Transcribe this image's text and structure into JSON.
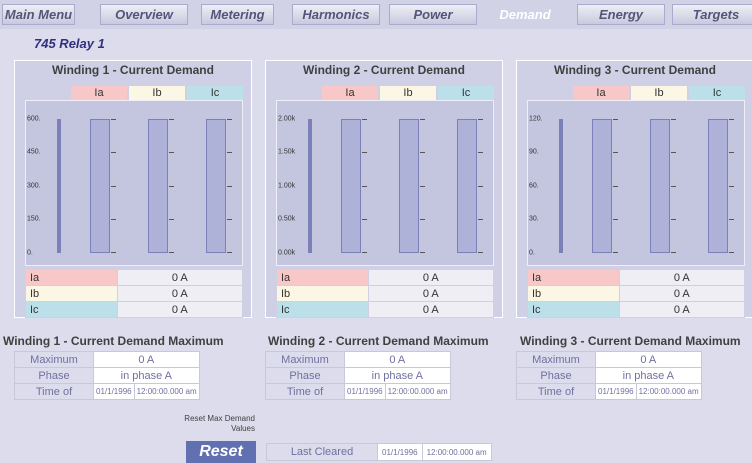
{
  "nav": {
    "tabs": [
      {
        "label": "Main Menu",
        "active": false
      },
      {
        "label": "Overview",
        "active": false
      },
      {
        "label": "Metering",
        "active": false
      },
      {
        "label": "Harmonics",
        "active": false
      },
      {
        "label": "Power",
        "active": false
      },
      {
        "label": "Demand",
        "active": true
      },
      {
        "label": "Energy",
        "active": false
      },
      {
        "label": "Targets",
        "active": false
      }
    ]
  },
  "relay_name": "745 Relay 1",
  "colors": {
    "ia": "#f8c8c8",
    "ib": "#fcf6e4",
    "ic": "#bce0ea",
    "bar_fill": "#5c63b0",
    "accent": "#6070b0"
  },
  "windings": [
    {
      "title": "Winding 1 - Current Demand",
      "phases": [
        "Ia",
        "Ib",
        "Ic"
      ],
      "ticks": [
        "600.",
        "450.",
        "300.",
        "150.",
        "0."
      ],
      "values": [
        "0 A",
        "0 A",
        "0 A"
      ],
      "levels": [
        0,
        0,
        0
      ],
      "max": {
        "title": "Winding 1 - Current Demand Maximum",
        "max_label": "Maximum",
        "max_value": "0 A",
        "phase_label": "Phase",
        "phase_value": "in phase A",
        "time_label": "Time of",
        "date": "01/1/1996",
        "time": "12:00:00.000 am"
      }
    },
    {
      "title": "Winding 2 - Current Demand",
      "phases": [
        "Ia",
        "Ib",
        "Ic"
      ],
      "ticks": [
        "2.00k",
        "1.50k",
        "1.00k",
        "0.50k",
        "0.00k"
      ],
      "values": [
        "0 A",
        "0 A",
        "0 A"
      ],
      "levels": [
        0,
        0,
        0
      ],
      "max": {
        "title": "Winding 2 - Current Demand Maximum",
        "max_label": "Maximum",
        "max_value": "0 A",
        "phase_label": "Phase",
        "phase_value": "in phase A",
        "time_label": "Time of",
        "date": "01/1/1996",
        "time": "12:00:00.000 am"
      }
    },
    {
      "title": "Winding 3 - Current Demand",
      "phases": [
        "Ia",
        "Ib",
        "Ic"
      ],
      "ticks": [
        "120.",
        "90.",
        "60.",
        "30.",
        "0."
      ],
      "values": [
        "0 A",
        "0 A",
        "0 A"
      ],
      "levels": [
        0,
        0,
        0
      ],
      "max": {
        "title": "Winding 3 - Current Demand Maximum",
        "max_label": "Maximum",
        "max_value": "0 A",
        "phase_label": "Phase",
        "phase_value": "in phase A",
        "time_label": "Time of",
        "date": "01/1/1996",
        "time": "12:00:00.000 am"
      }
    }
  ],
  "reset": {
    "label": "Reset Max Demand Values",
    "button": "Reset"
  },
  "last_cleared": {
    "label": "Last Cleared",
    "date": "01/1/1996",
    "time": "12:00:00.000 am"
  }
}
